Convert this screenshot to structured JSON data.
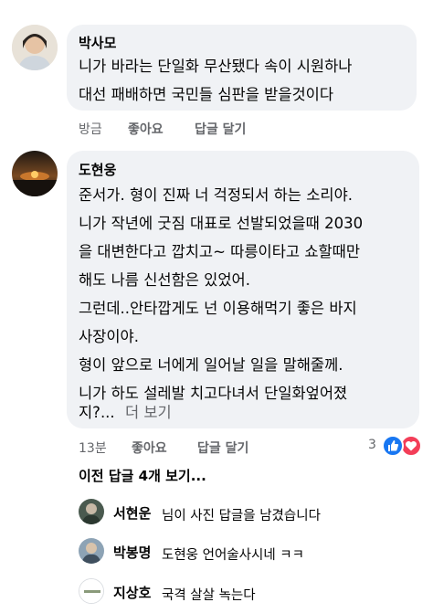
{
  "comments": [
    {
      "author": "박사모",
      "lines": [
        "니가 바라는 단일화 무산됐다 속이 시원하나",
        "대선 패배하면 국민들 심판을 받을것이다"
      ],
      "actions": {
        "timestamp": "방금",
        "like": "좋아요",
        "reply": "답글 달기"
      }
    },
    {
      "author": "도현웅",
      "lines": [
        "준서가. 형이 진짜 너 걱정되서 하는 소리야.",
        "니가 작년에 굿짐 대표로 선발되었을때 2030",
        "을 대변한다고 깝치고~ 따릉이타고 쇼할때만",
        "해도 나름 신선함은 있었어.",
        "그런데..안타깝게도 넌 이용해먹기 좋은 바지",
        "사장이야.",
        "형이 앞으로 너에게 일어날 일을 말해줄께.",
        "니가 하도 설레발 치고다녀서 단일화엎어졌",
        "지?..."
      ],
      "see_more": "더 보기",
      "actions": {
        "timestamp": "13분",
        "like": "좋아요",
        "reply": "답글 달기"
      },
      "reaction_count": "3"
    }
  ],
  "view_previous_replies": "이전 답글 4개 보기...",
  "replies": [
    {
      "author": "서현운",
      "text": "님이 사진 답글을 남겼습니다"
    },
    {
      "author": "박봉명",
      "text": "도현웅 언어술사시네 ㅋㅋ"
    },
    {
      "author": "지상호",
      "text": "국격 살살 녹는다"
    }
  ],
  "colors": {
    "bubble": "#f0f2f5",
    "secondary_text": "#65676b",
    "like_blue": "#1877f2",
    "love_red": "#f33e58"
  }
}
